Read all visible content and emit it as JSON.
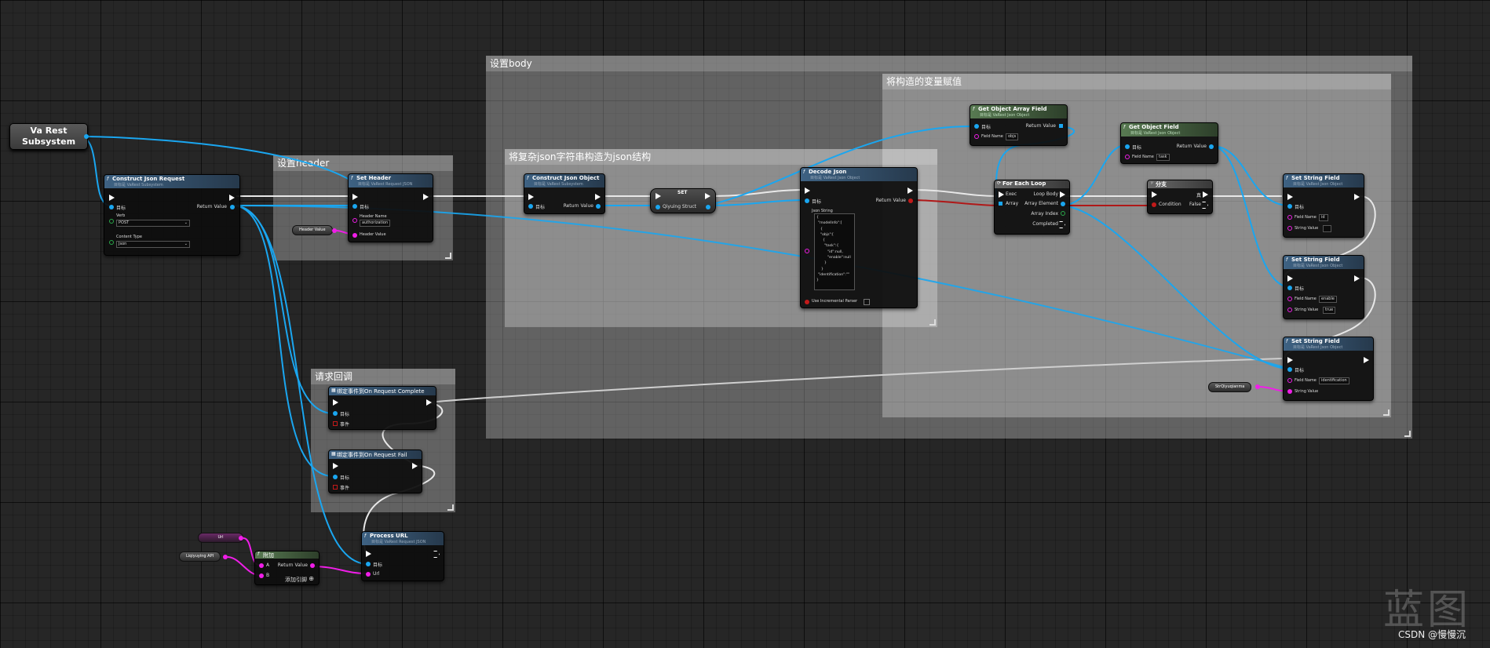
{
  "comments": {
    "set_body": "设置body",
    "assign_vars": "将构造的变量赋值",
    "decode": "将复杂json字符串构造为json结构",
    "set_header": "设置header",
    "callback": "请求回调"
  },
  "va_rest": {
    "line1": "Va Rest",
    "line2": "Subsystem"
  },
  "construct_request": {
    "title": "Construct Json Request",
    "subtitle": "目标是 VaRest Subsystem",
    "target": "目标",
    "return_value": "Return Value",
    "verb_label": "Verb",
    "verb_value": "POST",
    "content_type_label": "Content Type",
    "content_type_value": "Json"
  },
  "set_header": {
    "title": "Set Header",
    "subtitle": "目标是 VaRest Request JSON",
    "target": "目标",
    "header_name_label": "Header Name",
    "header_name_value": "authorization",
    "header_value_label": "Header Value"
  },
  "header_var": "Header Value",
  "construct_obj": {
    "title": "Construct Json Object",
    "subtitle": "目标是 VaRest Subsystem",
    "target": "目标",
    "return_value": "Return Value"
  },
  "set_node": {
    "title": "SET",
    "var": "Qiyuing Struct"
  },
  "decode_json": {
    "title": "Decode Json",
    "subtitle": "目标是 VaRest Json Object",
    "target": "目标",
    "return_value": "Return Value",
    "json_string_label": "Json String",
    "json_lines": [
      "{",
      "\"modelInfo\":[",
      "{",
      "\"objs\":[",
      "{",
      "\"task\":{",
      "\"id\":null,",
      "\"enable\":null",
      "}",
      "}",
      "\"identification\":\"\"",
      "}"
    ],
    "incremental": "Use Incremental Parser"
  },
  "get_array_field": {
    "title": "Get Object Array Field",
    "subtitle": "目标是 VaRest Json Object",
    "target": "目标",
    "return_value": "Return Value",
    "field_label": "Field Name",
    "field_value": "objs"
  },
  "get_object_field": {
    "title": "Get Object Field",
    "subtitle": "目标是 VaRest Json Object",
    "target": "目标",
    "return_value": "Return Value",
    "field_label": "Field Name",
    "field_value": "task"
  },
  "for_each": {
    "title": "For Each Loop",
    "exec": "Exec",
    "array": "Array",
    "loop_body": "Loop Body",
    "element": "Array Element",
    "index": "Array Index",
    "completed": "Completed"
  },
  "branch": {
    "title": "分支",
    "true_label": "真",
    "condition": "Condition",
    "false_label": "False"
  },
  "set_string_1": {
    "title": "Set String Field",
    "subtitle": "目标是 VaRest Json Object",
    "target": "目标",
    "field_label": "Field Name",
    "field_value": "id",
    "string_label": "String Value",
    "string_value": ""
  },
  "set_string_2": {
    "title": "Set String Field",
    "subtitle": "目标是 VaRest Json Object",
    "target": "目标",
    "field_label": "Field Name",
    "field_value": "enable",
    "string_label": "String Value",
    "string_value": "true"
  },
  "set_string_3": {
    "title": "Set String Field",
    "subtitle": "目标是 VaRest Json Object",
    "target": "目标",
    "field_label": "Field Name",
    "field_value": "identification",
    "string_label": "String Value"
  },
  "string_var": "StrQiyuqianma",
  "on_complete": {
    "title": "绑定事件到On Request Complete",
    "target": "目标",
    "event": "事件"
  },
  "on_fail": {
    "title": "绑定事件到On Request Fail",
    "target": "目标",
    "event": "事件"
  },
  "url_var": "Url",
  "api_var": "Liqiyuying API",
  "append": {
    "title": "附加",
    "a": "A",
    "b": "B",
    "return_value": "Return Value",
    "add_pin": "添加引脚"
  },
  "process_url": {
    "title": "Process URL",
    "subtitle": "目标是 VaRest Request JSON",
    "target": "目标",
    "url": "Url"
  },
  "watermark": {
    "logo": "蓝图",
    "credit": "CSDN @慢慢沉"
  },
  "colors": {
    "object_pin": "#1aa6f0",
    "string_pin": "#f01ee8",
    "bool_pin": "#c21a1a",
    "exec_wire": "#ffffff",
    "graph_bg": "#262626"
  }
}
